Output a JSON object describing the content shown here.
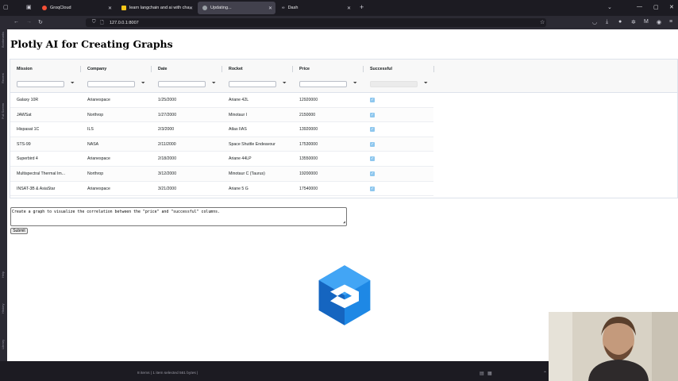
{
  "browser": {
    "tabs": [
      {
        "label": "GroqCloud",
        "color": "#f55036"
      },
      {
        "label": "learn langchain and ai with cha",
        "color": "#f5c518"
      },
      {
        "label": "Updating...",
        "color": "#9aa0a6"
      },
      {
        "label": "Dash",
        "color": "#cfcfd8"
      }
    ],
    "url": "127.0.0.1:8007",
    "sidebar_labels": [
      "Bookmarks",
      "Recent",
      "Full Screen",
      "Help",
      "History",
      "Library"
    ]
  },
  "page": {
    "title": "Plotly AI for Creating Graphs",
    "columns": [
      "Mission",
      "Company",
      "Date",
      "Rocket",
      "Price",
      "Successful"
    ],
    "rows": [
      {
        "mission": "Galaxy 10R",
        "company": "Arianespace",
        "date": "1/25/2000",
        "rocket": "Ariane 42L",
        "price": "12920000"
      },
      {
        "mission": "JAWSat",
        "company": "Northrop",
        "date": "1/27/2000",
        "rocket": "Minotaur I",
        "price": "2150000"
      },
      {
        "mission": "Hispasat 1C",
        "company": "ILS",
        "date": "2/3/2000",
        "rocket": "Atlas IIAS",
        "price": "13920000"
      },
      {
        "mission": "STS-99",
        "company": "NASA",
        "date": "2/11/2000",
        "rocket": "Space Shuttle Endeavour",
        "price": "17530000"
      },
      {
        "mission": "Superbird 4",
        "company": "Arianespace",
        "date": "2/18/2000",
        "rocket": "Ariane 44LP",
        "price": "13550000"
      },
      {
        "mission": "Multispectral Thermal Im...",
        "company": "Northrop",
        "date": "3/12/2000",
        "rocket": "Minotaur C (Taurus)",
        "price": "19200000"
      },
      {
        "mission": "INSAT-3B & AsiaStar",
        "company": "Arianespace",
        "date": "3/21/2000",
        "rocket": "Ariane 5 G",
        "price": "17540000"
      }
    ],
    "prompt_text": "Create a graph to visualize the correlation between the \"price\" and \"successful\" columns.",
    "submit_label": "Submit",
    "loader_color": "#1e88e5"
  },
  "status_bar": {
    "text": "8 items  |  1 item selected  561 bytes  |"
  }
}
